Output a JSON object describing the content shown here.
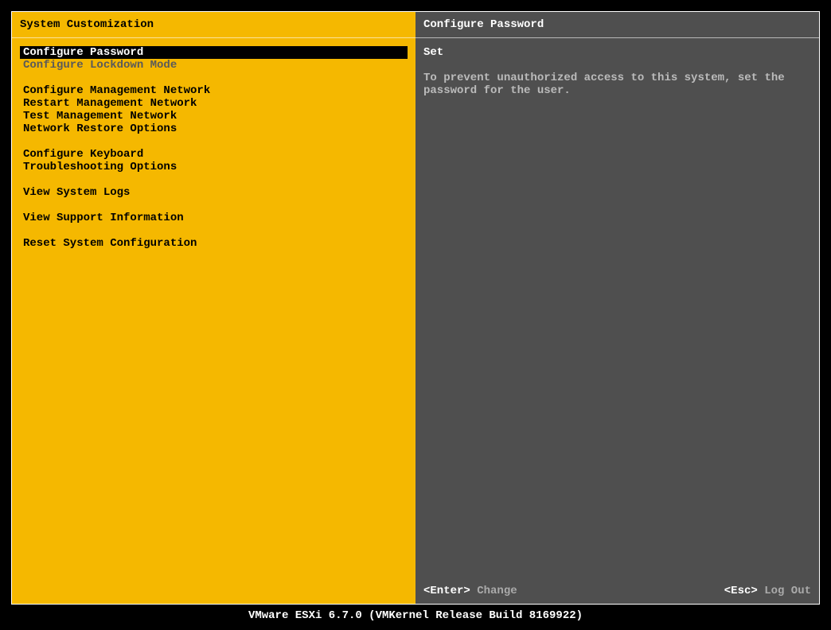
{
  "left": {
    "title": "System Customization",
    "groups": [
      [
        {
          "label": "Configure Password",
          "selected": true
        },
        {
          "label": "Configure Lockdown Mode",
          "dim": true
        }
      ],
      [
        {
          "label": "Configure Management Network"
        },
        {
          "label": "Restart Management Network"
        },
        {
          "label": "Test Management Network"
        },
        {
          "label": "Network Restore Options"
        }
      ],
      [
        {
          "label": "Configure Keyboard"
        },
        {
          "label": "Troubleshooting Options"
        }
      ],
      [
        {
          "label": "View System Logs"
        }
      ],
      [
        {
          "label": "View Support Information"
        }
      ],
      [
        {
          "label": "Reset System Configuration"
        }
      ]
    ]
  },
  "right": {
    "title": "Configure Password",
    "status": "Set",
    "description": "To prevent unauthorized access to this system, set the password for the user."
  },
  "keys": {
    "enter_key": "<Enter>",
    "enter_action": "Change",
    "esc_key": "<Esc>",
    "esc_action": "Log Out"
  },
  "footer": "VMware ESXi 6.7.0 (VMKernel Release Build 8169922)"
}
